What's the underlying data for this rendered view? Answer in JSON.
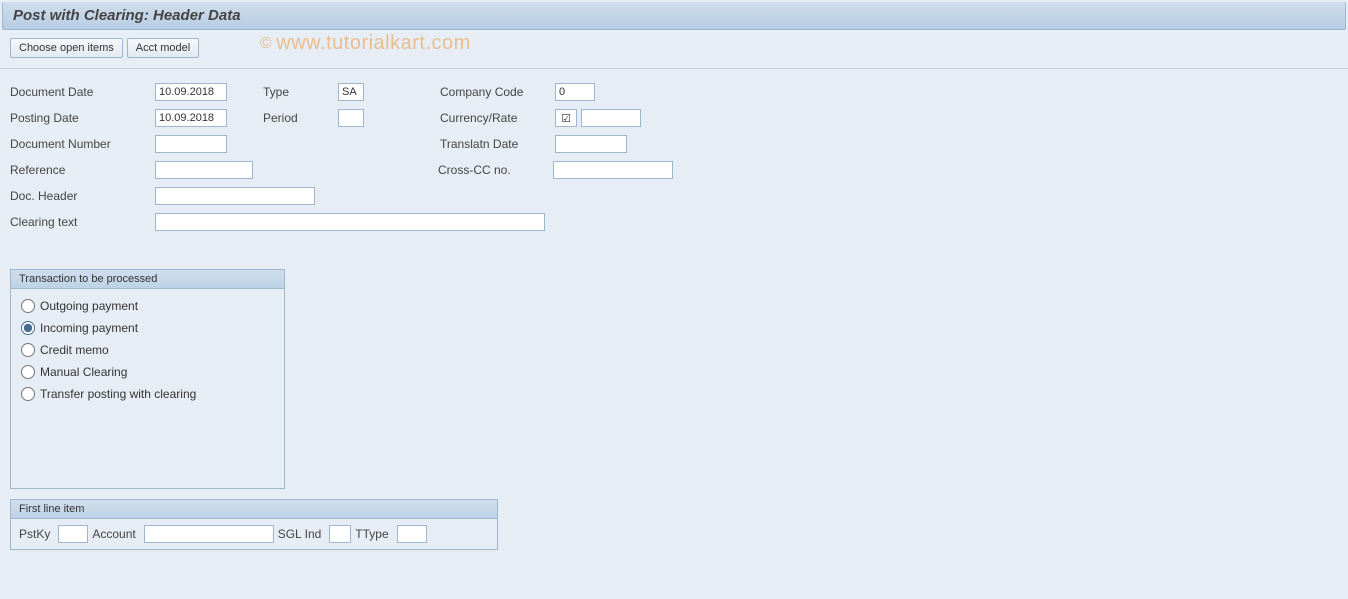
{
  "title": "Post with Clearing: Header Data",
  "toolbar": {
    "choose_open": "Choose open items",
    "acct_model": "Acct model"
  },
  "watermark": "www.tutorialkart.com",
  "labels": {
    "doc_date": "Document Date",
    "posting_date": "Posting Date",
    "doc_number": "Document Number",
    "reference": "Reference",
    "doc_header": "Doc. Header",
    "clearing_text": "Clearing text",
    "type": "Type",
    "period": "Period",
    "company_code": "Company Code",
    "currency_rate": "Currency/Rate",
    "translatn_date": "Translatn Date",
    "cross_cc": "Cross-CC no."
  },
  "values": {
    "doc_date": "10.09.2018",
    "posting_date": "10.09.2018",
    "doc_number": "",
    "reference": "",
    "doc_header": "",
    "clearing_text": "",
    "type": "SA",
    "period": "",
    "company_code": "0",
    "currency_check": "☑",
    "currency_rate": "",
    "translatn_date": "",
    "cross_cc": ""
  },
  "transaction": {
    "title": "Transaction to be processed",
    "options": {
      "outgoing": "Outgoing payment",
      "incoming": "Incoming payment",
      "credit": "Credit memo",
      "manual": "Manual Clearing",
      "transfer": "Transfer posting with clearing"
    },
    "selected": "incoming"
  },
  "firstline": {
    "title": "First line item",
    "pstky_label": "PstKy",
    "account_label": "Account",
    "sgl_label": "SGL Ind",
    "ttype_label": "TType",
    "pstky": "",
    "account": "",
    "sgl": "",
    "ttype": ""
  }
}
